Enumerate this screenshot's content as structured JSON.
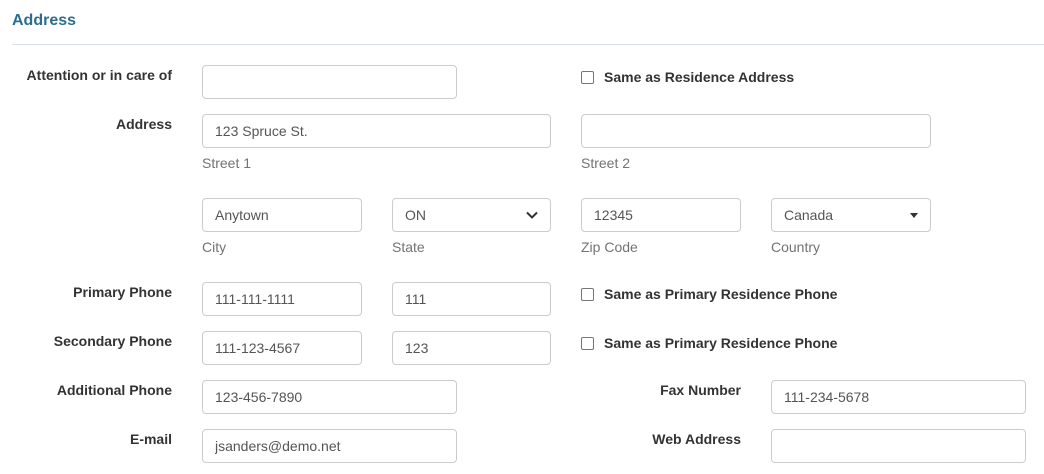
{
  "section": {
    "title": "Address"
  },
  "attention": {
    "label": "Attention or in care of",
    "value": ""
  },
  "same_residence_address": {
    "label": "Same as Residence Address",
    "checked": false
  },
  "address": {
    "label": "Address",
    "street1": {
      "value": "123 Spruce St.",
      "help": "Street 1"
    },
    "street2": {
      "value": "",
      "help": "Street 2"
    },
    "city": {
      "value": "Anytown",
      "help": "City"
    },
    "state": {
      "value": "ON",
      "help": "State",
      "icon": "chevron-down-icon"
    },
    "zip": {
      "value": "12345",
      "help": "Zip Code"
    },
    "country": {
      "value": "Canada",
      "help": "Country",
      "icon": "caret-down-icon"
    }
  },
  "primary_phone": {
    "label": "Primary Phone",
    "number": "111-111-1111",
    "ext": "111",
    "same_label": "Same as Primary Residence Phone",
    "same_checked": false
  },
  "secondary_phone": {
    "label": "Secondary Phone",
    "number": "111-123-4567",
    "ext": "123",
    "same_label": "Same as Primary Residence Phone",
    "same_checked": false
  },
  "additional_phone": {
    "label": "Additional Phone",
    "number": "123-456-7890"
  },
  "fax": {
    "label": "Fax Number",
    "number": "111-234-5678"
  },
  "email": {
    "label": "E-mail",
    "value": "jsanders@demo.net"
  },
  "web": {
    "label": "Web Address",
    "value": ""
  }
}
